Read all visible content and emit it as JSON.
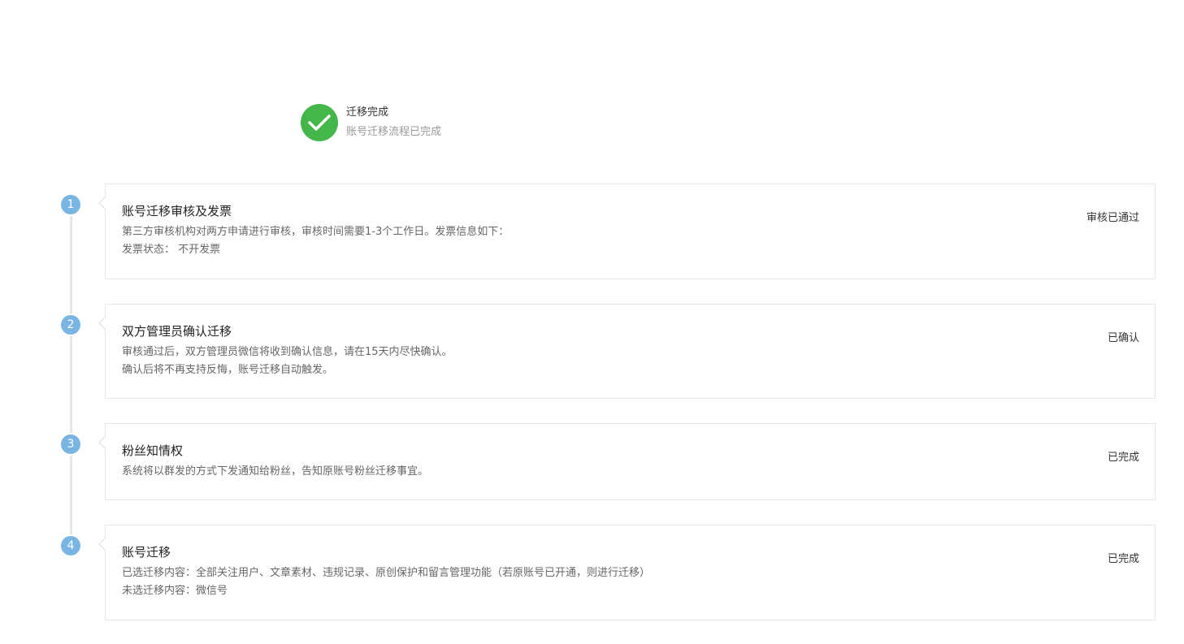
{
  "status": {
    "title": "迁移完成",
    "subtitle": "账号迁移流程已完成",
    "icon": "check-icon",
    "icon_color": "#45b64a"
  },
  "steps": [
    {
      "number": "1",
      "title": "账号迁移审核及发票",
      "status": "审核已通过",
      "lines": [
        "第三方审核机构对两方申请进行审核，审核时间需要1-3个工作日。发票信息如下：",
        "发票状态：   不开发票"
      ]
    },
    {
      "number": "2",
      "title": "双方管理员确认迁移",
      "status": "已确认",
      "lines": [
        "审核通过后，双方管理员微信将收到确认信息，请在15天内尽快确认。",
        "确认后将不再支持反悔，账号迁移自动触发。"
      ]
    },
    {
      "number": "3",
      "title": "粉丝知情权",
      "status": "已完成",
      "lines": [
        "系统将以群发的方式下发通知给粉丝，告知原账号粉丝迁移事宜。"
      ]
    },
    {
      "number": "4",
      "title": "账号迁移",
      "status": "已完成",
      "lines": [
        "已选迁移内容：全部关注用户、文章素材、违规记录、原创保护和留言管理功能（若原账号已开通，则进行迁移）",
        "未选迁移内容：微信号"
      ]
    }
  ],
  "colors": {
    "step_badge": "#79b5e3",
    "border": "#e6e6e6",
    "text_muted": "#666666",
    "text_light": "#999999"
  }
}
